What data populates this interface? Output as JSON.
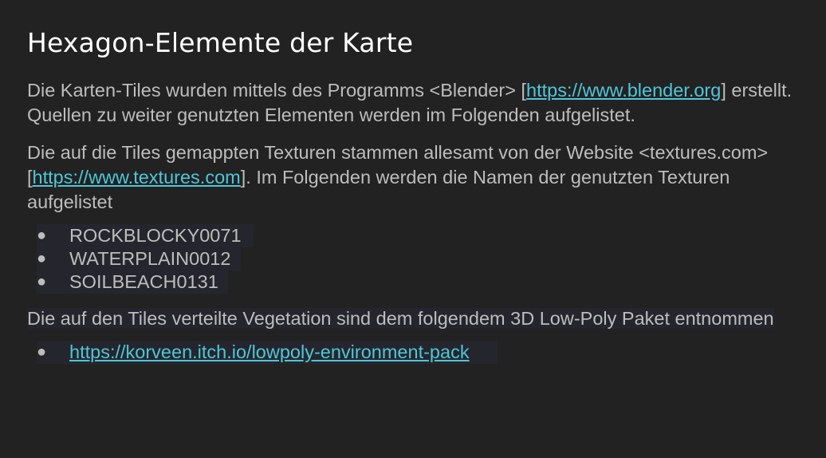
{
  "slide": {
    "title": "Hexagon-Elemente der Karte",
    "paragraph1": {
      "text_before": "Die Karten-Tiles wurden mittels des Programms <Blender> [",
      "link": "https://www.blender.org",
      "text_after": "] erstellt. Quellen zu weiter genutzten Elementen werden im Folgenden aufgelistet."
    },
    "paragraph2": {
      "text_before": "Die auf die Tiles gemappten Texturen stammen allesamt von der Website <textures.com> [",
      "link": "https://www.textures.com",
      "text_after": "]. Im Folgenden werden die Namen der genutzten Texturen aufgelistet"
    },
    "textures_list": [
      "ROCKBLOCKY0071",
      "WATERPLAIN0012",
      "SOILBEACH0131"
    ],
    "paragraph3": "Die auf den Tiles verteilte Vegetation sind dem folgendem 3D Low-Poly Paket entnommen",
    "vegetation_list": [
      "https://korveen.itch.io/lowpoly-environment-pack"
    ],
    "bullet_glyph": "●"
  },
  "colors": {
    "background": "#222222",
    "title": "#ffffff",
    "body_text": "#bdbdbd",
    "link": "#4fc6d8",
    "highlight": "#25262d"
  }
}
